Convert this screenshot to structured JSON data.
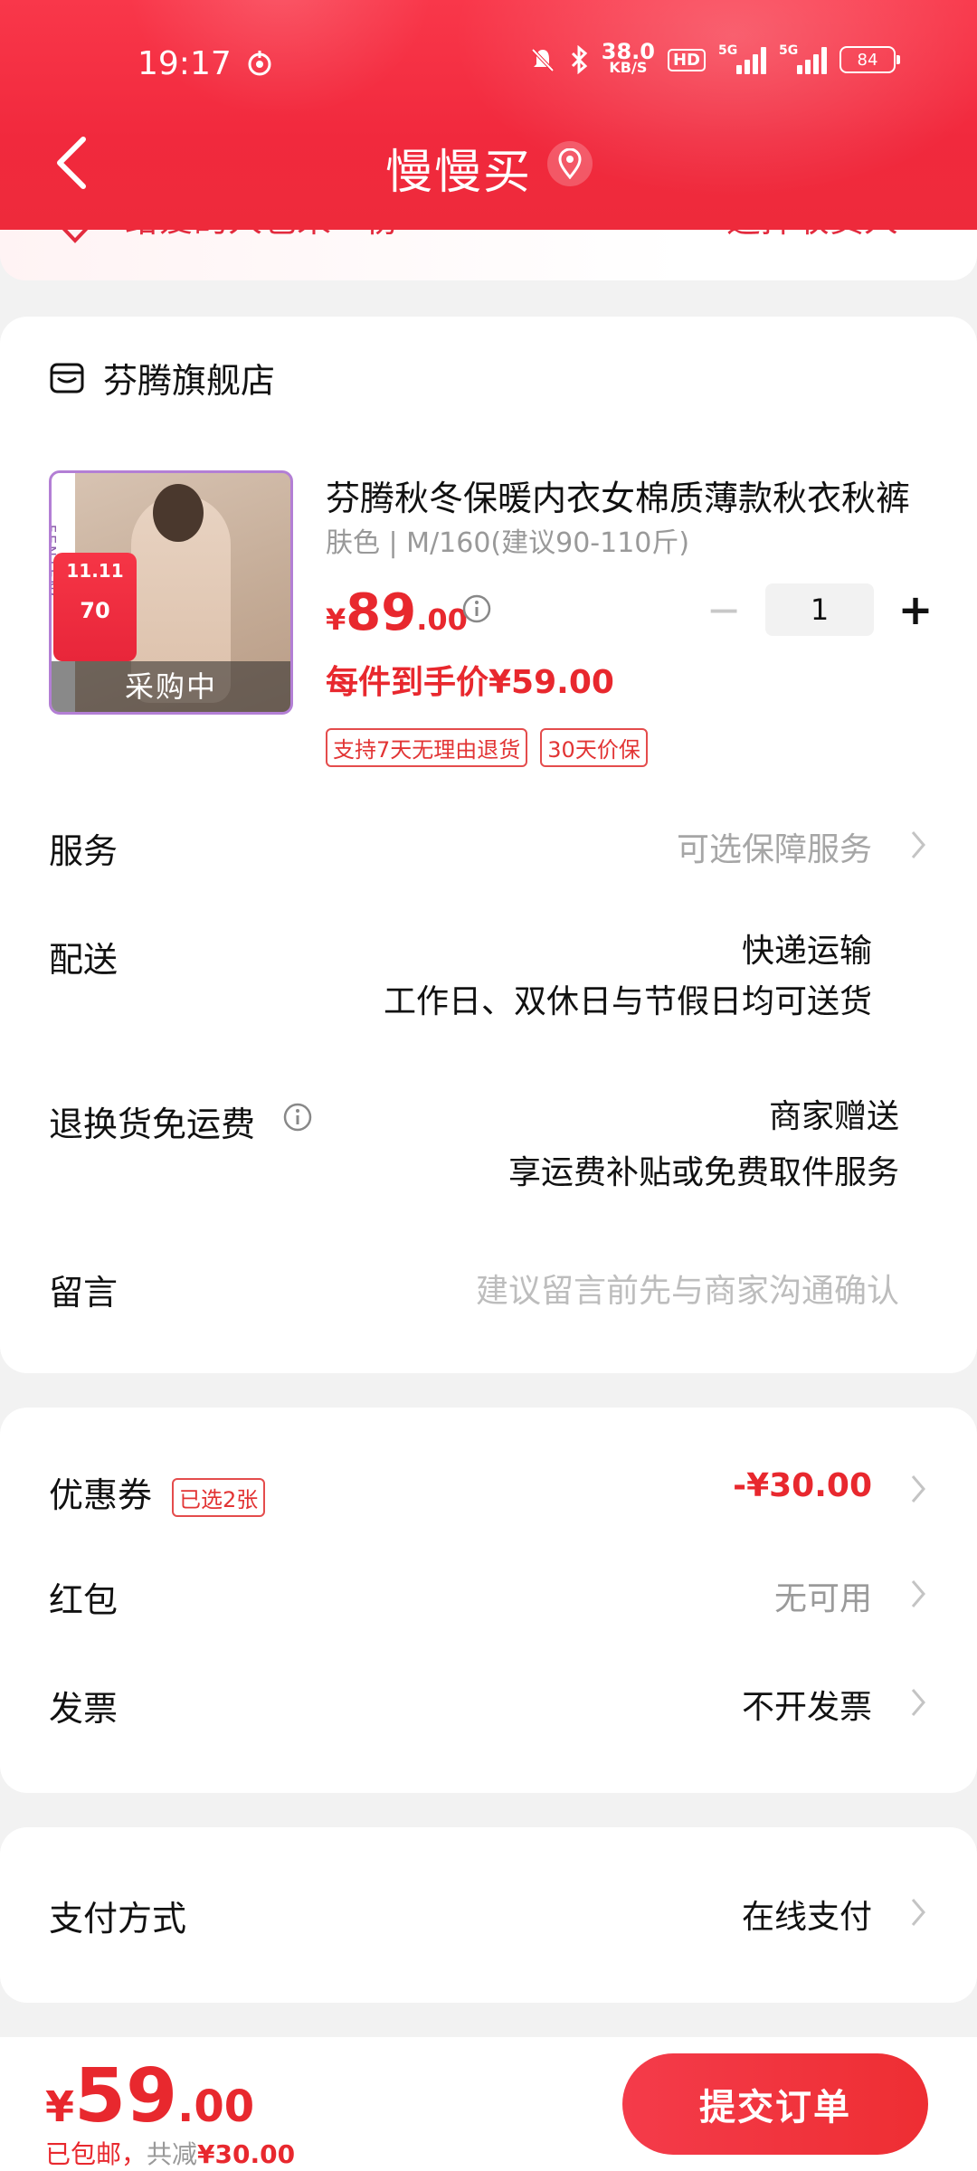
{
  "status_bar": {
    "time": "19:17",
    "net_speed": "38.0",
    "net_unit": "KB/S",
    "hd_label": "HD",
    "signal1_label": "5G",
    "signal2_label": "5G",
    "battery": "84"
  },
  "header": {
    "title": "慢慢买",
    "accent_color": "#f1293d"
  },
  "address": {
    "left_text": "给爱的人也来一份",
    "right_text": "选择收货人 ›"
  },
  "shop": {
    "name": "芬腾旗舰店",
    "product": {
      "title": "芬腾秋冬保暖内衣女棉质薄款秋衣秋裤",
      "spec": "肤色 | M/160(建议90-110斤)",
      "price_currency": "¥",
      "price_int": "89",
      "price_dec": ".00",
      "quantity": "1",
      "unit_price": "每件到手价¥59.00",
      "thumb_overlay": "采购中",
      "thumb_badge": "11.11",
      "thumb_badge_num": "70",
      "thumb_brand": "FENTENG",
      "tags": [
        "支持7天无理由退货",
        "30天价保"
      ]
    },
    "service": {
      "label": "服务",
      "value": "可选保障服务"
    },
    "delivery": {
      "label": "配送",
      "value_line1": "快递运输",
      "value_line2": "工作日、双休日与节假日均可送货"
    },
    "return_shipping": {
      "label": "退换货免运费",
      "value_line1": "商家赠送",
      "value_line2": "享运费补贴或免费取件服务"
    },
    "message": {
      "label": "留言",
      "placeholder": "建议留言前先与商家沟通确认"
    }
  },
  "promotions": {
    "coupon": {
      "label": "优惠券",
      "tag": "已选2张",
      "value": "-¥30.00"
    },
    "red_packet": {
      "label": "红包",
      "value": "无可用"
    },
    "invoice": {
      "label": "发票",
      "value": "不开发票"
    }
  },
  "payment": {
    "label": "支付方式",
    "value": "在线支付"
  },
  "bottom": {
    "currency": "¥",
    "total_int": "59",
    "total_dec": ".00",
    "shipping_note": "已包邮，",
    "saved_prefix": "共减",
    "saved_amount": "¥30.00",
    "submit_label": "提交订单"
  }
}
